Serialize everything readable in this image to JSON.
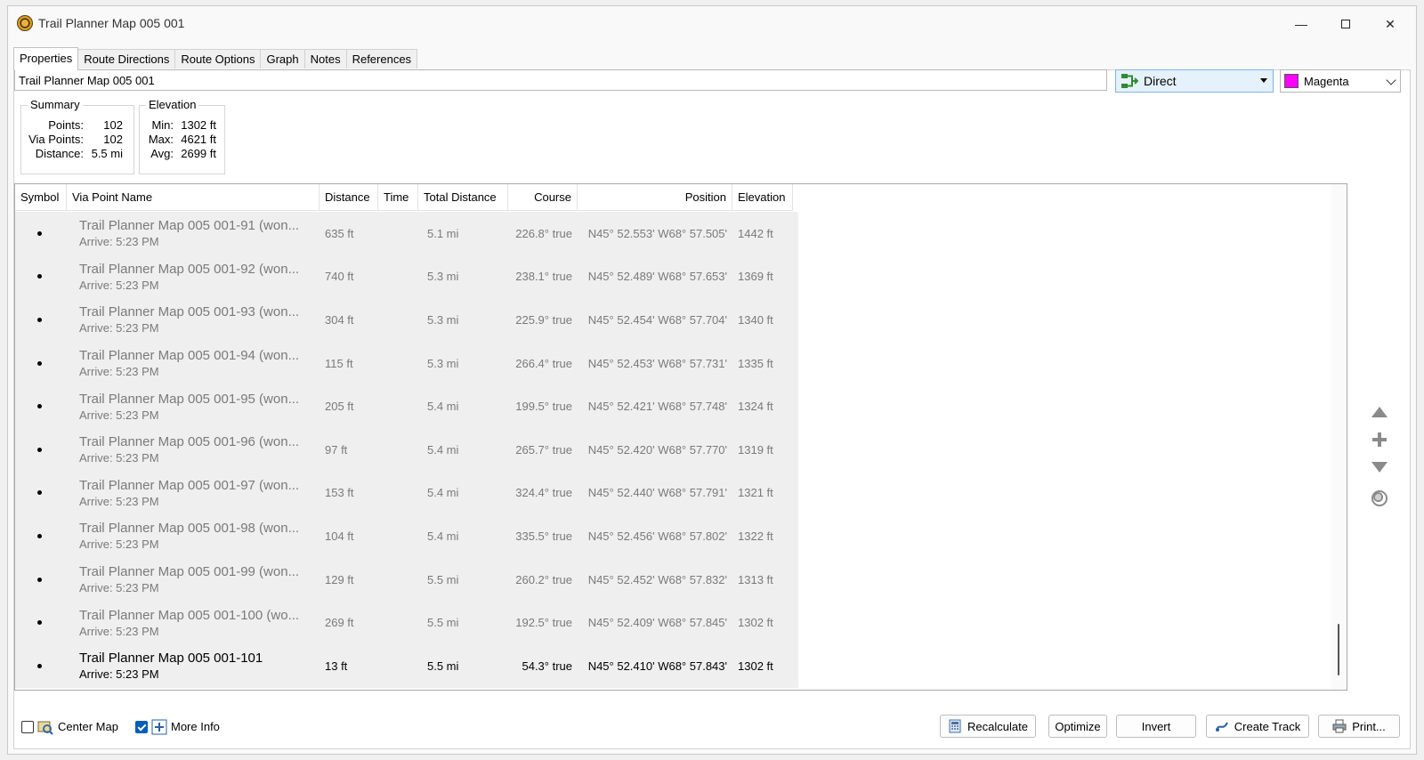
{
  "window": {
    "title": "Trail Planner Map 005 001",
    "min_glyph": "—",
    "close_glyph": "✕"
  },
  "tabs": [
    {
      "label": "Properties",
      "active": true
    },
    {
      "label": "Route Directions"
    },
    {
      "label": "Route Options"
    },
    {
      "label": "Graph"
    },
    {
      "label": "Notes"
    },
    {
      "label": "References"
    }
  ],
  "properties": {
    "name_value": "Trail Planner Map 005 001",
    "route_mode": "Direct",
    "color": {
      "label": "Magenta",
      "hex": "#ff00ff"
    }
  },
  "summary": {
    "title": "Summary",
    "points_label": "Points:",
    "points": "102",
    "via_points_label": "Via Points:",
    "via_points": "102",
    "distance_label": "Distance:",
    "distance": "5.5 mi"
  },
  "elevation": {
    "title": "Elevation",
    "min_label": "Min:",
    "min": "1302 ft",
    "max_label": "Max:",
    "max": "4621 ft",
    "avg_label": "Avg:",
    "avg": "2699 ft"
  },
  "table": {
    "columns": [
      "Symbol",
      "Via Point Name",
      "Distance",
      "Time",
      "Total Distance",
      "Course",
      "Position",
      "Elevation"
    ],
    "rows": [
      {
        "name": "Trail Planner Map 005 001-91 (won...",
        "arrive": "Arrive: 5:23 PM",
        "distance": "635 ft",
        "time": "",
        "total": "5.1 mi",
        "course": "226.8° true",
        "position": "N45° 52.553' W68° 57.505'",
        "elevation": "1442 ft"
      },
      {
        "name": "Trail Planner Map 005 001-92 (won...",
        "arrive": "Arrive: 5:23 PM",
        "distance": "740 ft",
        "time": "",
        "total": "5.3 mi",
        "course": "238.1° true",
        "position": "N45° 52.489' W68° 57.653'",
        "elevation": "1369 ft"
      },
      {
        "name": "Trail Planner Map 005 001-93 (won...",
        "arrive": "Arrive: 5:23 PM",
        "distance": "304 ft",
        "time": "",
        "total": "5.3 mi",
        "course": "225.9° true",
        "position": "N45° 52.454' W68° 57.704'",
        "elevation": "1340 ft"
      },
      {
        "name": "Trail Planner Map 005 001-94 (won...",
        "arrive": "Arrive: 5:23 PM",
        "distance": "115 ft",
        "time": "",
        "total": "5.3 mi",
        "course": "266.4° true",
        "position": "N45° 52.453' W68° 57.731'",
        "elevation": "1335 ft"
      },
      {
        "name": "Trail Planner Map 005 001-95 (won...",
        "arrive": "Arrive: 5:23 PM",
        "distance": "205 ft",
        "time": "",
        "total": "5.4 mi",
        "course": "199.5° true",
        "position": "N45° 52.421' W68° 57.748'",
        "elevation": "1324 ft"
      },
      {
        "name": "Trail Planner Map 005 001-96 (won...",
        "arrive": "Arrive: 5:23 PM",
        "distance": "97 ft",
        "time": "",
        "total": "5.4 mi",
        "course": "265.7° true",
        "position": "N45° 52.420' W68° 57.770'",
        "elevation": "1319 ft"
      },
      {
        "name": "Trail Planner Map 005 001-97 (won...",
        "arrive": "Arrive: 5:23 PM",
        "distance": "153 ft",
        "time": "",
        "total": "5.4 mi",
        "course": "324.4° true",
        "position": "N45° 52.440' W68° 57.791'",
        "elevation": "1321 ft"
      },
      {
        "name": "Trail Planner Map 005 001-98 (won...",
        "arrive": "Arrive: 5:23 PM",
        "distance": "104 ft",
        "time": "",
        "total": "5.4 mi",
        "course": "335.5° true",
        "position": "N45° 52.456' W68° 57.802'",
        "elevation": "1322 ft"
      },
      {
        "name": "Trail Planner Map 005 001-99 (won...",
        "arrive": "Arrive: 5:23 PM",
        "distance": "129 ft",
        "time": "",
        "total": "5.5 mi",
        "course": "260.2° true",
        "position": "N45° 52.452' W68° 57.832'",
        "elevation": "1313 ft"
      },
      {
        "name": "Trail Planner Map 005 001-100 (wo...",
        "arrive": "Arrive: 5:23 PM",
        "distance": "269 ft",
        "time": "",
        "total": "5.5 mi",
        "course": "192.5° true",
        "position": "N45° 52.409' W68° 57.845'",
        "elevation": "1302 ft"
      },
      {
        "name": "Trail Planner Map 005 001-101",
        "arrive": "Arrive: 5:23 PM",
        "distance": "13 ft",
        "time": "",
        "total": "5.5 mi",
        "course": "54.3° true",
        "position": "N45° 52.410' W68° 57.843'",
        "elevation": "1302 ft",
        "selected": true
      }
    ]
  },
  "side_icons": [
    "move-up-icon",
    "insert-icon",
    "move-down-icon",
    "globe-icon"
  ],
  "bottom": {
    "center_map": {
      "label": "Center Map",
      "checked": false
    },
    "more_info": {
      "label": "More Info",
      "checked": true
    },
    "buttons": {
      "recalculate": "Recalculate",
      "optimize": "Optimize",
      "invert": "Invert",
      "create_track": "Create Track",
      "print": "Print..."
    }
  }
}
